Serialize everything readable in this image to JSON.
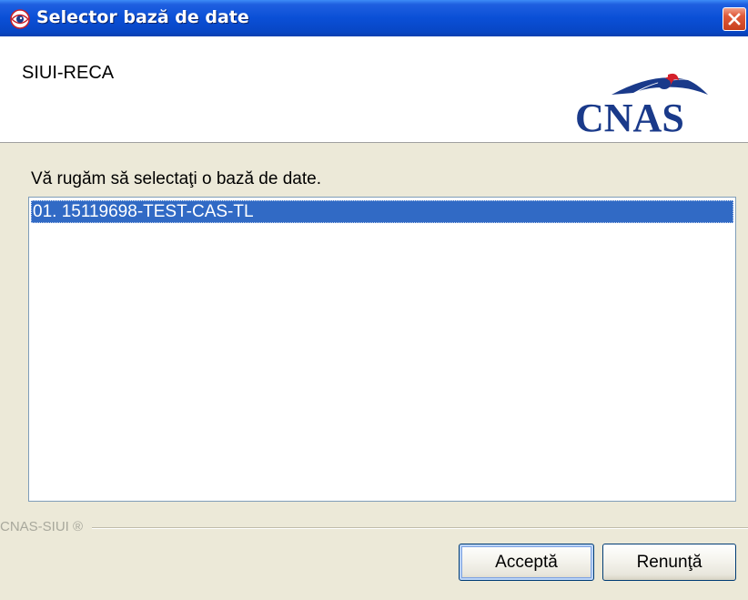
{
  "window": {
    "title": "Selector bază de date",
    "icon": "app-eye-icon",
    "close_icon": "close-icon"
  },
  "header": {
    "app_name": "SIUI-RECA",
    "logo_text": "CNAS"
  },
  "body": {
    "prompt": "Vă rugăm să selectaţi o bază de date.",
    "databases": [
      {
        "label": "01. 15119698-TEST-CAS-TL",
        "selected": true
      }
    ]
  },
  "footer": {
    "label": "CNAS-SIUI ®",
    "accept_label": "Acceptă",
    "cancel_label": "Renunţă"
  },
  "colors": {
    "titlebar": "#0a4fd6",
    "selection": "#316ac5",
    "dialog_bg": "#ece9d8",
    "close_button": "#e05a3a",
    "logo_blue": "#1a3a8a",
    "logo_red": "#d4202a"
  }
}
